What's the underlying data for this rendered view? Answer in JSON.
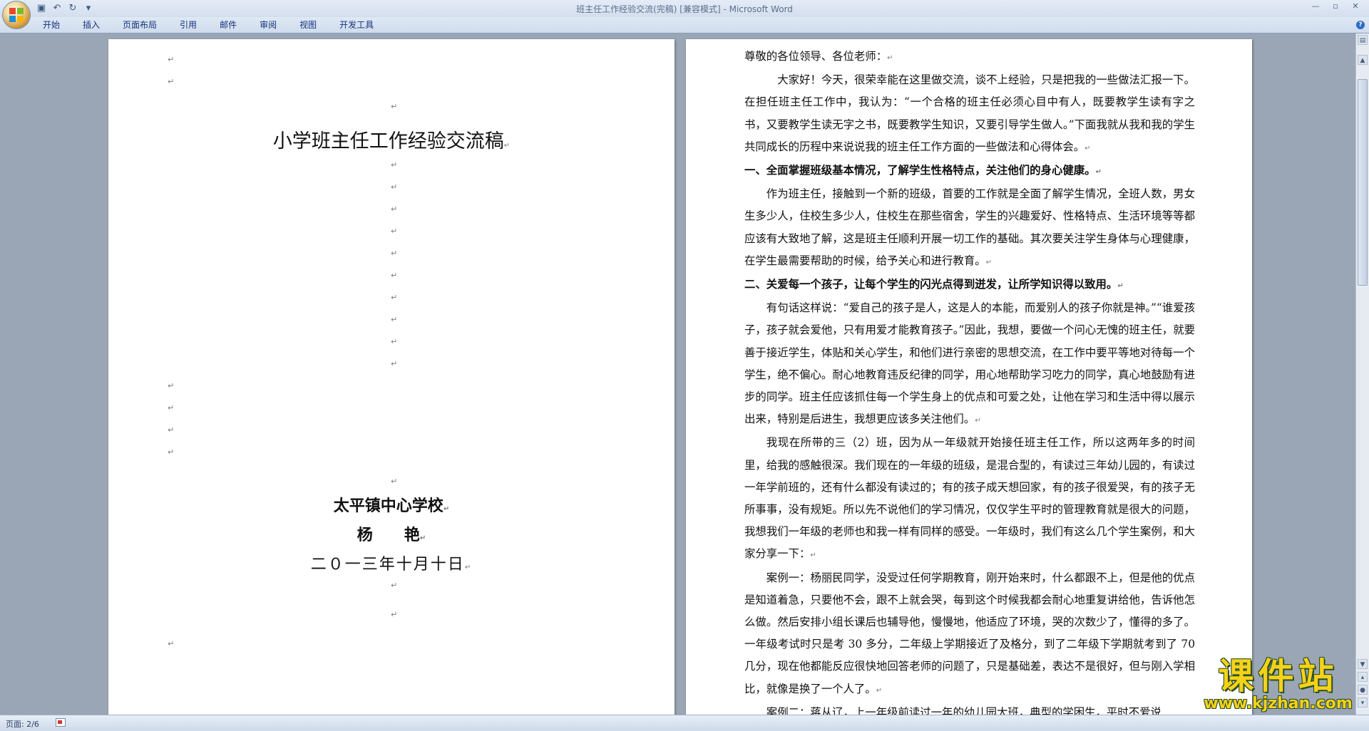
{
  "window": {
    "title": "班主任工作经验交流(完稿) [兼容模式] - Microsoft Word",
    "controls": [
      "—",
      "▫",
      "✕"
    ]
  },
  "quick_access": {
    "save_icon": "save-icon",
    "undo_icon": "undo-icon",
    "redo_icon": "redo-icon",
    "customize_icon": "customize-arrow-icon"
  },
  "ribbon": {
    "tabs": [
      "开始",
      "插入",
      "页面布局",
      "引用",
      "邮件",
      "审阅",
      "视图",
      "开发工具"
    ],
    "help": "?"
  },
  "left_page": {
    "title": "小学班主任工作经验交流稿",
    "school": "太平镇中心学校",
    "author": "杨　　艳",
    "date": "二０一三年十月十日",
    "para_mark": "↵"
  },
  "right_page": {
    "paragraphs": [
      {
        "style": "plain",
        "text": "尊敬的各位领导、各位老师："
      },
      {
        "style": "indent",
        "text": "　大家好！今天，很荣幸能在这里做交流，谈不上经验，只是把我的一些做法汇报一下。在担任班主任工作中，我认为：“一个合格的班主任必须心目中有人，既要教学生读有字之书，又要教学生读无字之书，既要教学生知识，又要引导学生做人。”下面我就从我和我的学生共同成长的历程中来说说我的班主任工作方面的一些做法和心得体会。"
      },
      {
        "style": "head",
        "text": "一、全面掌握班级基本情况，了解学生性格特点，关注他们的身心健康。"
      },
      {
        "style": "indent",
        "text": "作为班主任，接触到一个新的班级，首要的工作就是全面了解学生情况，全班人数，男女生多少人，住校生多少人，住校生在那些宿舍，学生的兴趣爱好、性格特点、生活环境等等都应该有大致地了解，这是班主任顺利开展一切工作的基础。其次要关注学生身体与心理健康，在学生最需要帮助的时候，给予关心和进行教育。"
      },
      {
        "style": "head",
        "text": "二、关爱每一个孩子，让每个学生的闪光点得到迸发，让所学知识得以致用。"
      },
      {
        "style": "indent",
        "text": "有句话这样说：“爱自己的孩子是人，这是人的本能，而爱别人的孩子你就是神。”“谁爱孩子，孩子就会爱他，只有用爱才能教育孩子。”因此，我想，要做一个问心无愧的班主任，就要善于接近学生，体贴和关心学生，和他们进行亲密的思想交流，在工作中要平等地对待每一个学生，绝不偏心。耐心地教育违反纪律的同学，用心地帮助学习吃力的同学，真心地鼓励有进步的同学。班主任应该抓住每一个学生身上的优点和可爱之处，让他在学习和生活中得以展示出来，特别是后进生，我想更应该多关注他们。"
      },
      {
        "style": "indent",
        "text": "我现在所带的三（2）班，因为从一年级就开始接任班主任工作，所以这两年多的时间里，给我的感触很深。我们现在的一年级的班级，是混合型的，有读过三年幼儿园的，有读过一年学前班的，还有什么都没有读过的；有的孩子成天想回家，有的孩子很爱哭，有的孩子无所事事，没有规矩。所以先不说他们的学习情况，仅仅学生平时的管理教育就是很大的问题，我想我们一年级的老师也和我一样有同样的感受。一年级时，我们有这么几个学生案例，和大家分享一下："
      },
      {
        "style": "indent",
        "text": "案例一：杨丽民同学，没受过任何学期教育，刚开始来时，什么都跟不上，但是他的优点是知道着急，只要他不会，跟不上就会哭，每到这个时候我都会耐心地重复讲给他，告诉他怎么做。然后安排小组长课后也辅导他，慢慢地，他适应了环境，哭的次数少了，懂得的多了。一年级考试时只是考 30 多分，二年级上学期接近了及格分，到了二年级下学期就考到了 70 几分，现在他都能反应很快地回答老师的问题了，只是基础差，表达不是很好，但与刚入学相比，就像是换了一个人了。"
      },
      {
        "style": "indent",
        "text": "案例二：蒋从辽，上一年级前读过一年的幼儿园大班，典型的学困生，平时不爱说"
      }
    ]
  },
  "status_bar": {
    "page_info": "页面: 2/6"
  },
  "watermark": {
    "main": "课件站",
    "sub": "www.kjzhan.com"
  }
}
